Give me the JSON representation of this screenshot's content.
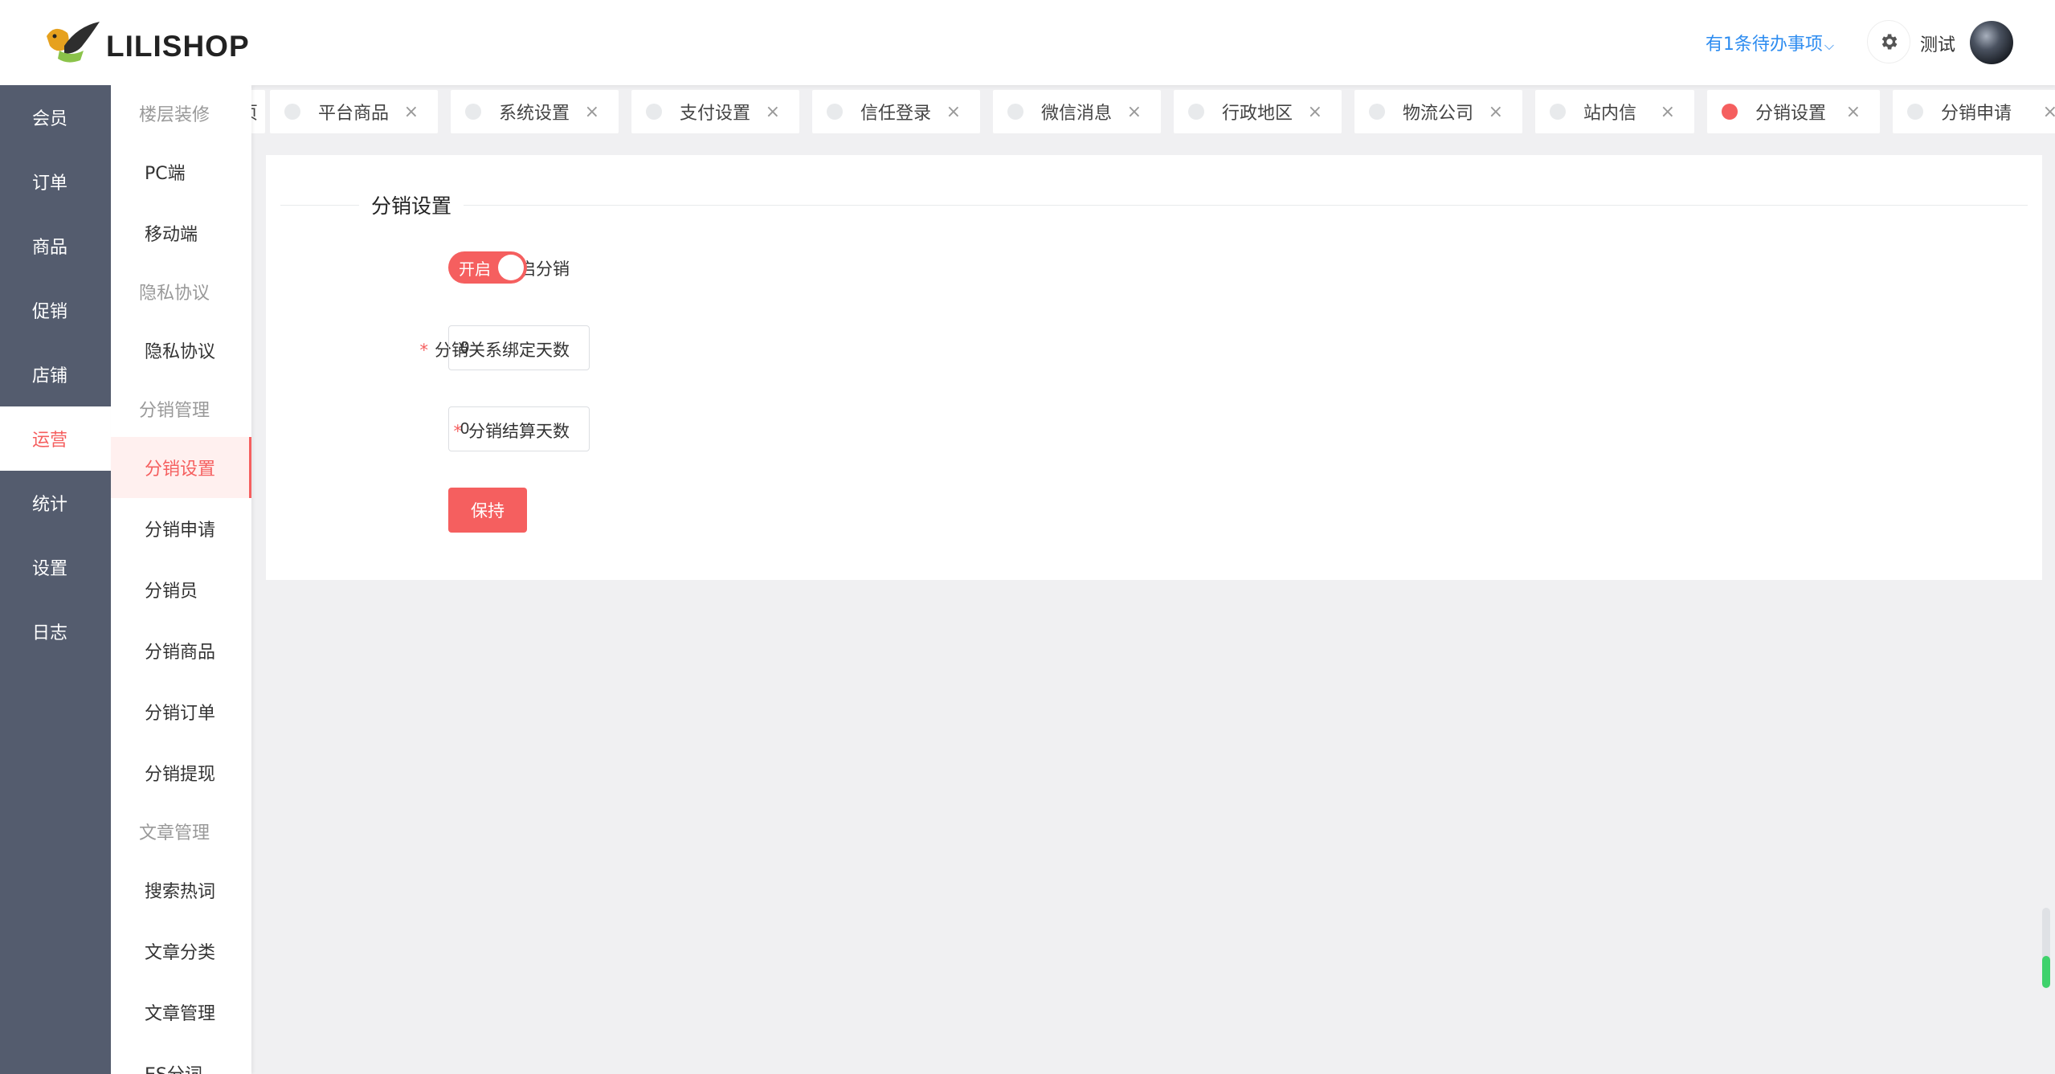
{
  "brand": {
    "logo_text": "LILISHOP",
    "accent": "#f55f5f",
    "nav_bg": "#545c6e",
    "link": "#2d8cf0"
  },
  "header": {
    "todo": "有1条待办事项",
    "username": "测试"
  },
  "nav": {
    "items": [
      "会员",
      "订单",
      "商品",
      "促销",
      "店铺",
      "运营",
      "统计",
      "设置",
      "日志"
    ],
    "active": "运营"
  },
  "submenu": {
    "rows": [
      {
        "type": "group",
        "label": "楼层装修"
      },
      {
        "type": "item",
        "label": "PC端"
      },
      {
        "type": "item",
        "label": "移动端"
      },
      {
        "type": "group",
        "label": "隐私协议"
      },
      {
        "type": "item",
        "label": "隐私协议"
      },
      {
        "type": "group",
        "label": "分销管理"
      },
      {
        "type": "item",
        "label": "分销设置",
        "active": true
      },
      {
        "type": "item",
        "label": "分销申请"
      },
      {
        "type": "item",
        "label": "分销员"
      },
      {
        "type": "item",
        "label": "分销商品"
      },
      {
        "type": "item",
        "label": "分销订单"
      },
      {
        "type": "item",
        "label": "分销提现"
      },
      {
        "type": "group",
        "label": "文章管理"
      },
      {
        "type": "item",
        "label": "搜索热词"
      },
      {
        "type": "item",
        "label": "文章分类"
      },
      {
        "type": "item",
        "label": "文章管理"
      },
      {
        "type": "item",
        "label": "ES分词"
      }
    ]
  },
  "tabs": [
    {
      "label": "页",
      "partial": true
    },
    {
      "label": "平台商品"
    },
    {
      "label": "系统设置"
    },
    {
      "label": "支付设置"
    },
    {
      "label": "信任登录"
    },
    {
      "label": "微信消息"
    },
    {
      "label": "行政地区"
    },
    {
      "label": "物流公司"
    },
    {
      "label": "站内信"
    },
    {
      "label": "分销设置",
      "active": true
    },
    {
      "label": "分销申请"
    }
  ],
  "form": {
    "section_title": "分销设置",
    "enable": {
      "label": "是否开启分销",
      "switch_text": "开启"
    },
    "bind_days": {
      "label": "分销关系绑定天数",
      "value": "0"
    },
    "settle_days": {
      "label": "分销结算天数",
      "value": "0"
    },
    "save_label": "保持",
    "required_mark": "*"
  },
  "icons": {
    "close": "×",
    "chevron": "⌵"
  }
}
